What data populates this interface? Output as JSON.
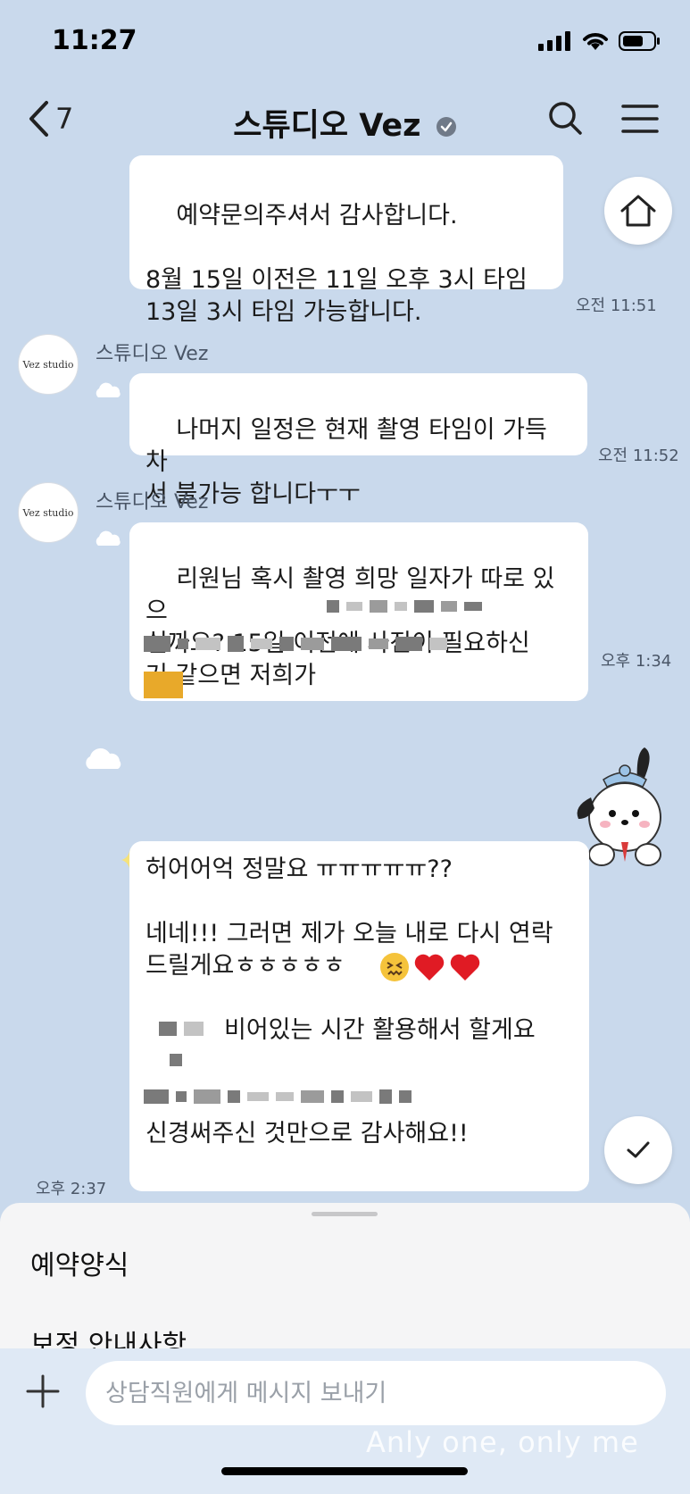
{
  "status_bar": {
    "time": "11:27"
  },
  "header": {
    "back_count": "7",
    "title": "스튜디오 Vez"
  },
  "messages": [
    {
      "sender": "",
      "text": "예약문의주셔서 감사합니다.\n\n8월 15일 이전은 11일 오후 3시 타임\n13일 3시 타임 가능합니다.",
      "time": "오전 11:51"
    },
    {
      "sender": "스튜디오 Vez",
      "avatar_text": "Vez studio",
      "text": "나머지 일정은 현재 촬영 타임이 가득 차\n서 불가능 합니다ㅜㅜ",
      "time": "오전 11:52"
    },
    {
      "sender": "스튜디오 Vez",
      "avatar_text": "Vez studio",
      "text": "리원님 혹시 촬영 희망 일자가 따로 있으\n실까요? 15일 이전에 사진이 필요하신\n거 같으면 저희가",
      "time": "오후 1:34"
    },
    {
      "sender": "me",
      "line1": "허어어억 정말요 ㅠㅠㅠㅠㅠ??",
      "line2": "네네!!! 그러면 제가 오늘 내로 다시 연락\n드릴게요ㅎㅎㅎㅎㅎ",
      "line3": "비어있는 시간 활용해서 할게요",
      "line4": "신경써주신 것만으로 감사해요!!",
      "time": "오후 2:37"
    }
  ],
  "sheet": {
    "items": [
      "예약양식",
      "보정 안내사항"
    ]
  },
  "input": {
    "placeholder": "상담직원에게 메시지 보내기"
  },
  "watermark": "Anly one, only me",
  "icons": [
    "chevron-left-icon",
    "verified-badge-icon",
    "search-icon",
    "menu-icon",
    "home-icon",
    "check-icon",
    "plus-icon",
    "cloud-icon",
    "sticker-icon"
  ]
}
